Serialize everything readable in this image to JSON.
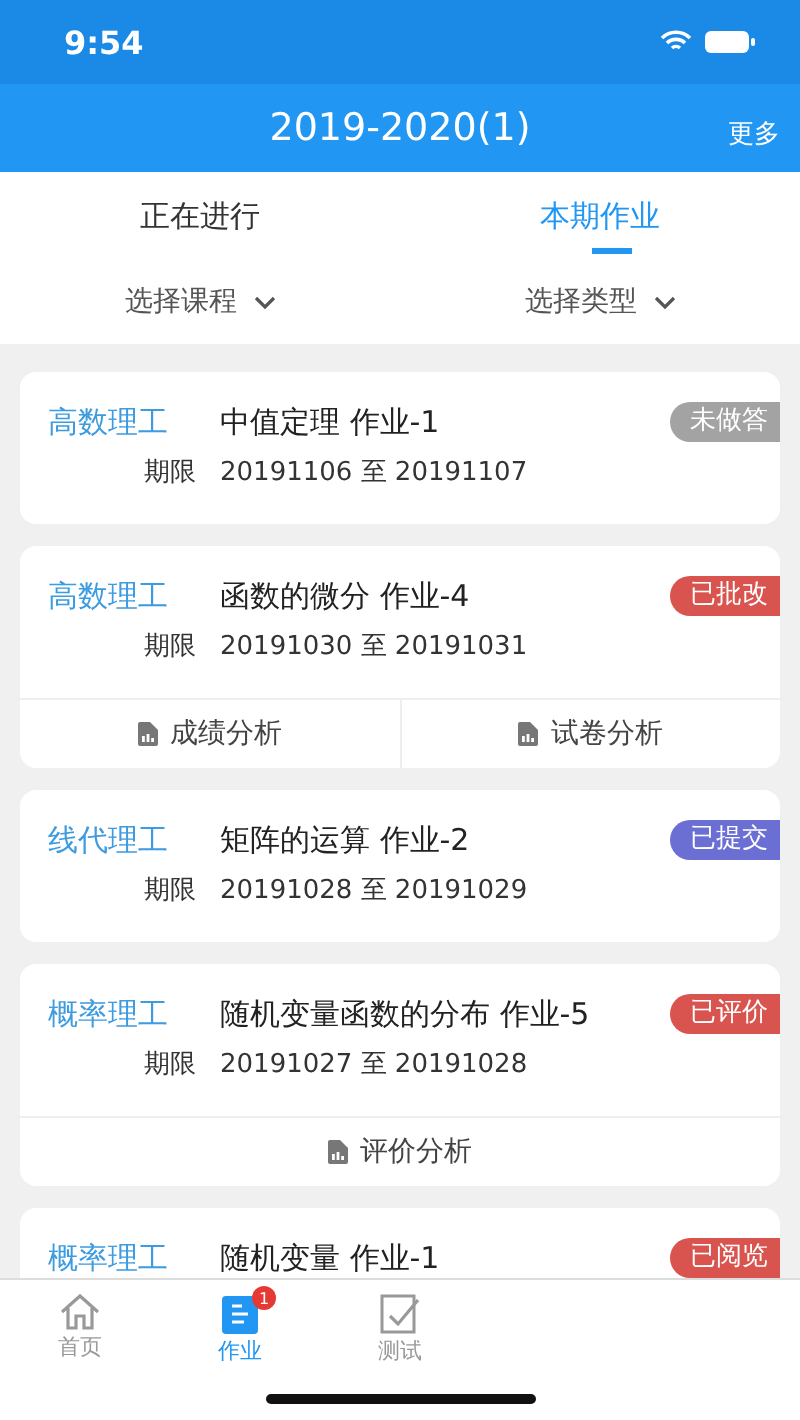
{
  "status_bar": {
    "time": "9:54"
  },
  "header": {
    "title": "2019-2020(1)",
    "action": "更多"
  },
  "tabs": [
    {
      "label": "正在进行",
      "selected": false
    },
    {
      "label": "本期作业",
      "selected": true
    }
  ],
  "filters": [
    {
      "label": "选择课程"
    },
    {
      "label": "选择类型"
    }
  ],
  "assignments": [
    {
      "course": "高数理工",
      "title": "中值定理 作业-1",
      "period_label": "期限",
      "period": "20191106 至 20191107",
      "status": "未做答",
      "color": "#a3a3a3"
    },
    {
      "course": "高数理工",
      "title": "函数的微分 作业-4",
      "period_label": "期限",
      "period": "20191030 至 20191031",
      "status": "已批改",
      "color": "#d9534f",
      "actions": [
        "成绩分析",
        "试卷分析"
      ]
    },
    {
      "course": "线代理工",
      "title": "矩阵的运算 作业-2",
      "period_label": "期限",
      "period": "20191028 至 20191029",
      "status": "已提交",
      "color": "#6b6fd4"
    },
    {
      "course": "概率理工",
      "title": "随机变量函数的分布 作业-5",
      "period_label": "期限",
      "period": "20191027 至 20191028",
      "status": "已评价",
      "color": "#d9534f",
      "actions": [
        "评价分析"
      ]
    },
    {
      "course": "概率理工",
      "title": "随机变量 作业-1",
      "status": "已阅览",
      "color": "#d9534f"
    }
  ],
  "tab_bar": [
    {
      "label": "首页",
      "kind": "home",
      "selected": false
    },
    {
      "label": "作业",
      "kind": "homework",
      "selected": true,
      "badge": "1"
    },
    {
      "label": "测试",
      "kind": "test",
      "selected": false
    }
  ]
}
